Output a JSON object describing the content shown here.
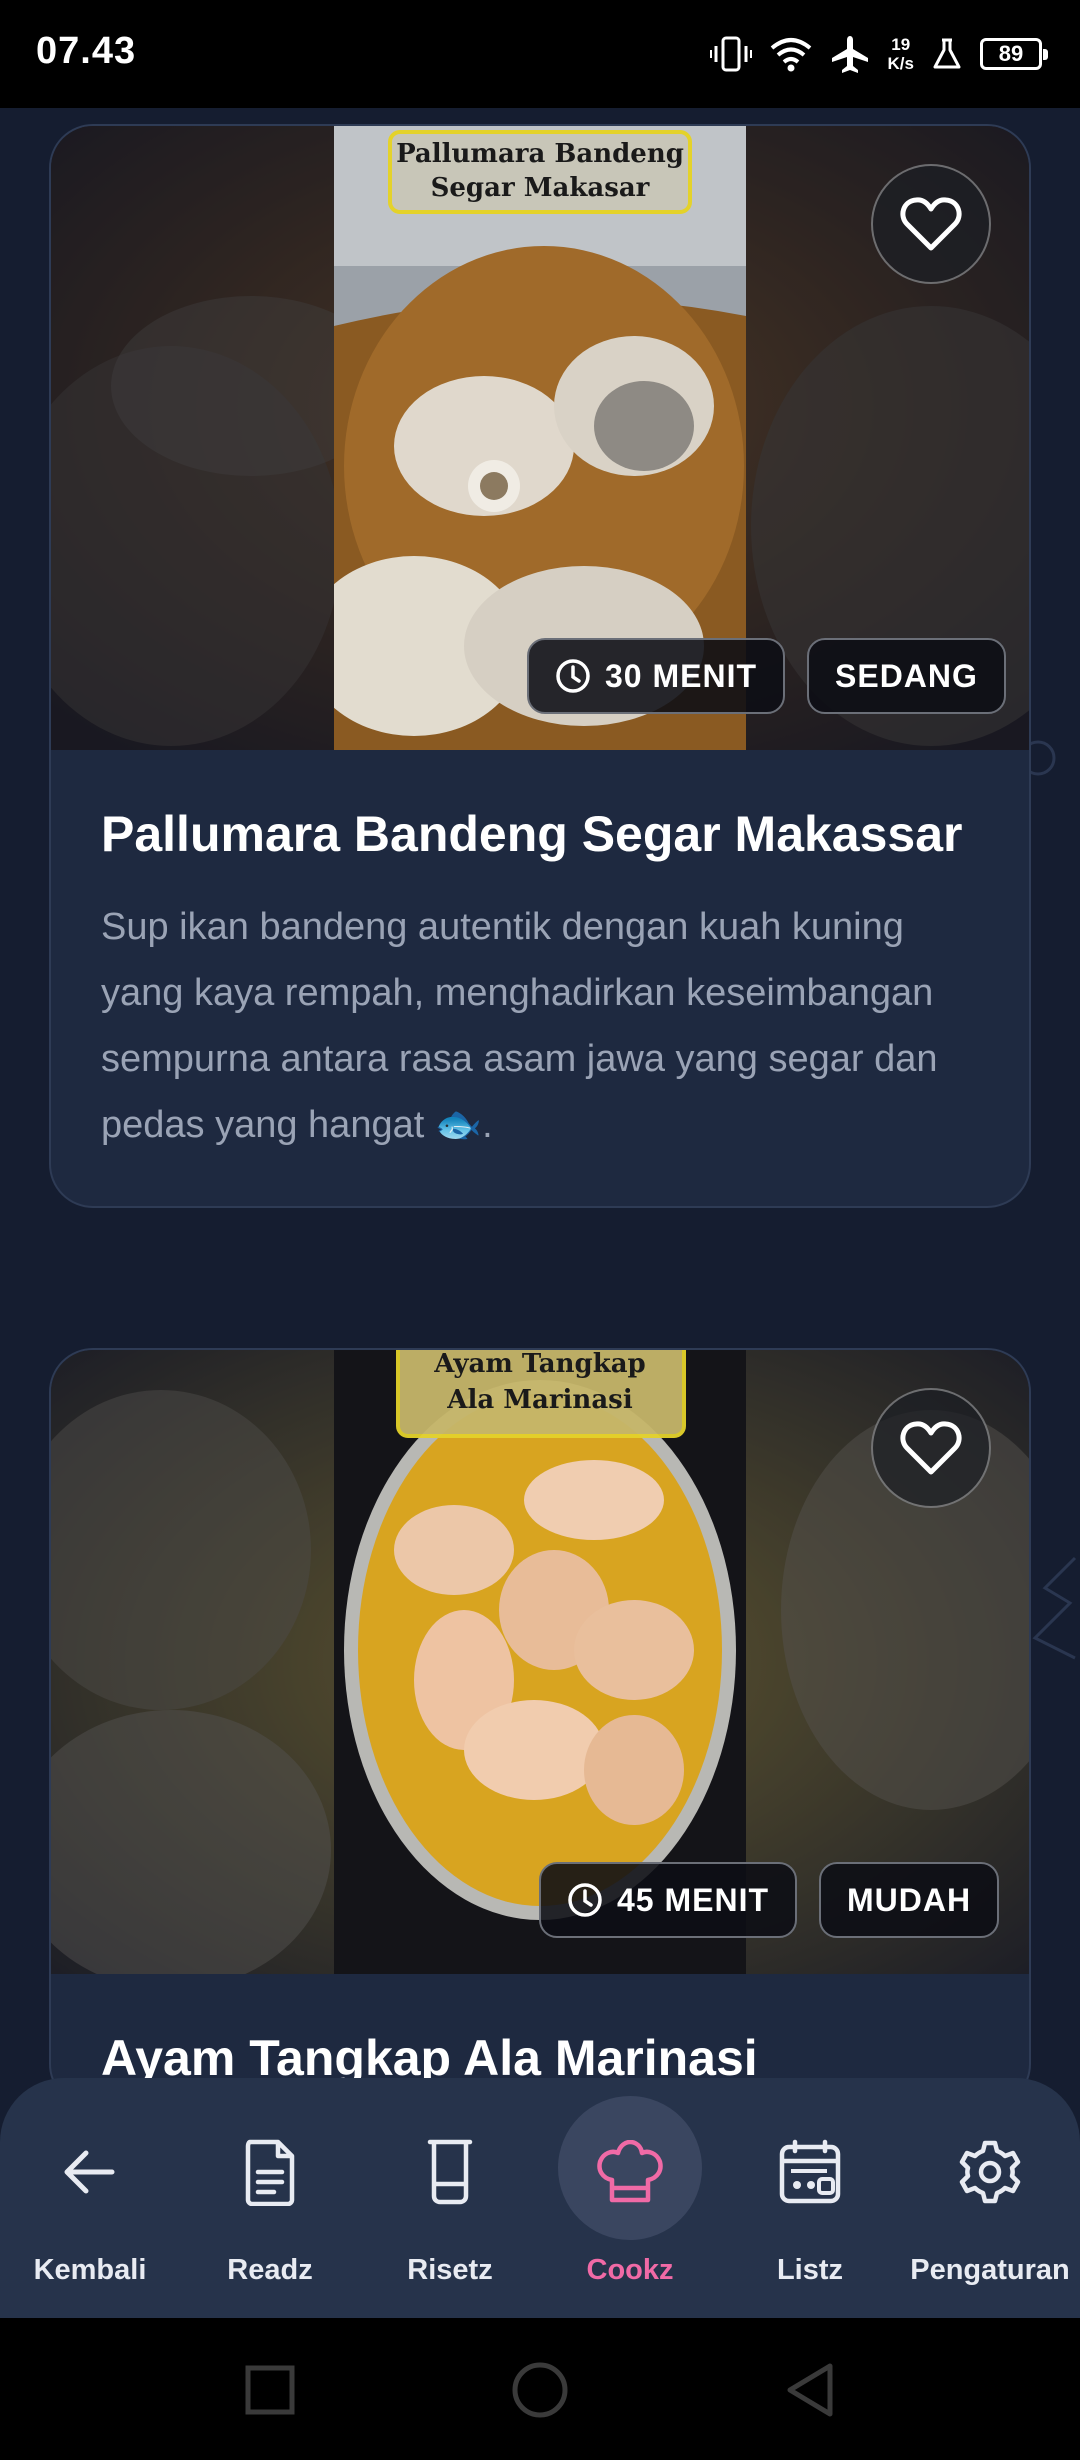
{
  "status_bar": {
    "time": "07.43",
    "net_speed_value": "19",
    "net_speed_unit": "K/s",
    "battery": "89"
  },
  "recipes": [
    {
      "image_caption": "Pallumara Bandeng Segar Makasar",
      "time": "30 MENIT",
      "difficulty": "SEDANG",
      "title": "Pallumara Bandeng Segar Makassar",
      "description": "Sup ikan bandeng autentik dengan kuah kuning yang kaya rempah, menghadirkan keseimbangan sempurna antara rasa asam jawa yang segar dan pedas yang hangat 🐟."
    },
    {
      "image_caption": "Ayam Tangkap Ala Marinasi",
      "time": "45 MENIT",
      "difficulty": "MUDAH",
      "title": "Ayam Tangkap Ala Marinasi",
      "description": ""
    }
  ],
  "bottom_nav": {
    "items": [
      {
        "label": "Kembali",
        "icon": "arrow-left-icon"
      },
      {
        "label": "Readz",
        "icon": "document-icon"
      },
      {
        "label": "Risetz",
        "icon": "beaker-icon"
      },
      {
        "label": "Cookz",
        "icon": "chef-hat-icon",
        "active": true
      },
      {
        "label": "Listz",
        "icon": "list-calendar-icon"
      },
      {
        "label": "Pengaturan",
        "icon": "gear-icon"
      }
    ]
  },
  "colors": {
    "background": "#151d30",
    "card": "#1e2940",
    "nav": "#26334b",
    "accent": "#f06aa6"
  }
}
